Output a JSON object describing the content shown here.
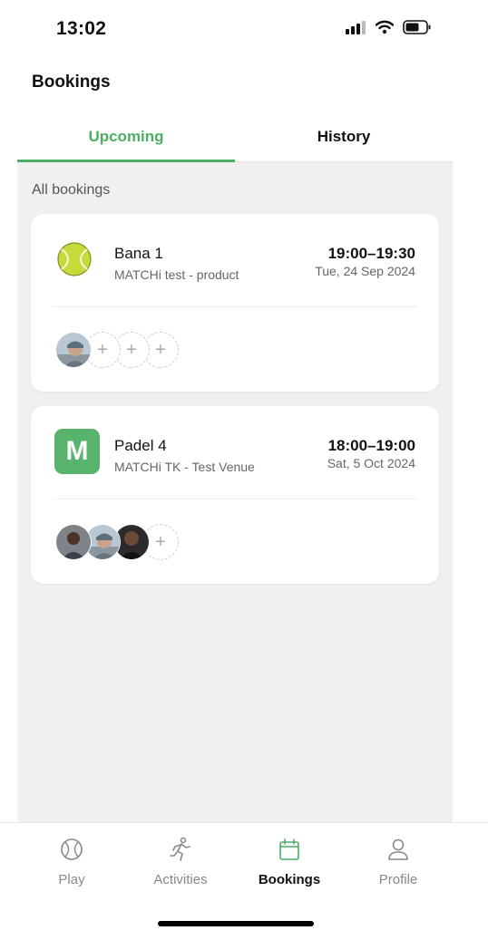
{
  "status": {
    "time": "13:02",
    "icons": [
      "signal-icon",
      "wifi-icon",
      "battery-icon"
    ]
  },
  "page": {
    "title": "Bookings"
  },
  "tabs": [
    {
      "label": "Upcoming",
      "active": true
    },
    {
      "label": "History",
      "active": false
    }
  ],
  "section": {
    "label": "All bookings"
  },
  "bookings": [
    {
      "icon": "tennis-ball-icon",
      "court": "Bana 1",
      "venue": "MATCHi test - product",
      "time": "19:00–19:30",
      "date": "Tue, 24 Sep 2024",
      "players_filled": 1,
      "players_total": 4
    },
    {
      "icon": "matchi-logo-icon",
      "icon_letter": "M",
      "court": "Padel 4",
      "venue": "MATCHi TK - Test Venue",
      "time": "18:00–19:00",
      "date": "Sat, 5 Oct 2024",
      "players_filled": 3,
      "players_total": 4
    }
  ],
  "empty_slot_symbol": "+",
  "nav": [
    {
      "label": "Play",
      "icon": "ball-icon",
      "active": false
    },
    {
      "label": "Activities",
      "icon": "runner-icon",
      "active": false
    },
    {
      "label": "Bookings",
      "icon": "calendar-icon",
      "active": true
    },
    {
      "label": "Profile",
      "icon": "person-icon",
      "active": false
    }
  ],
  "colors": {
    "accent": "#4caf63",
    "background": "#f0f0f0",
    "tennis_ball": "#c6db3a"
  }
}
